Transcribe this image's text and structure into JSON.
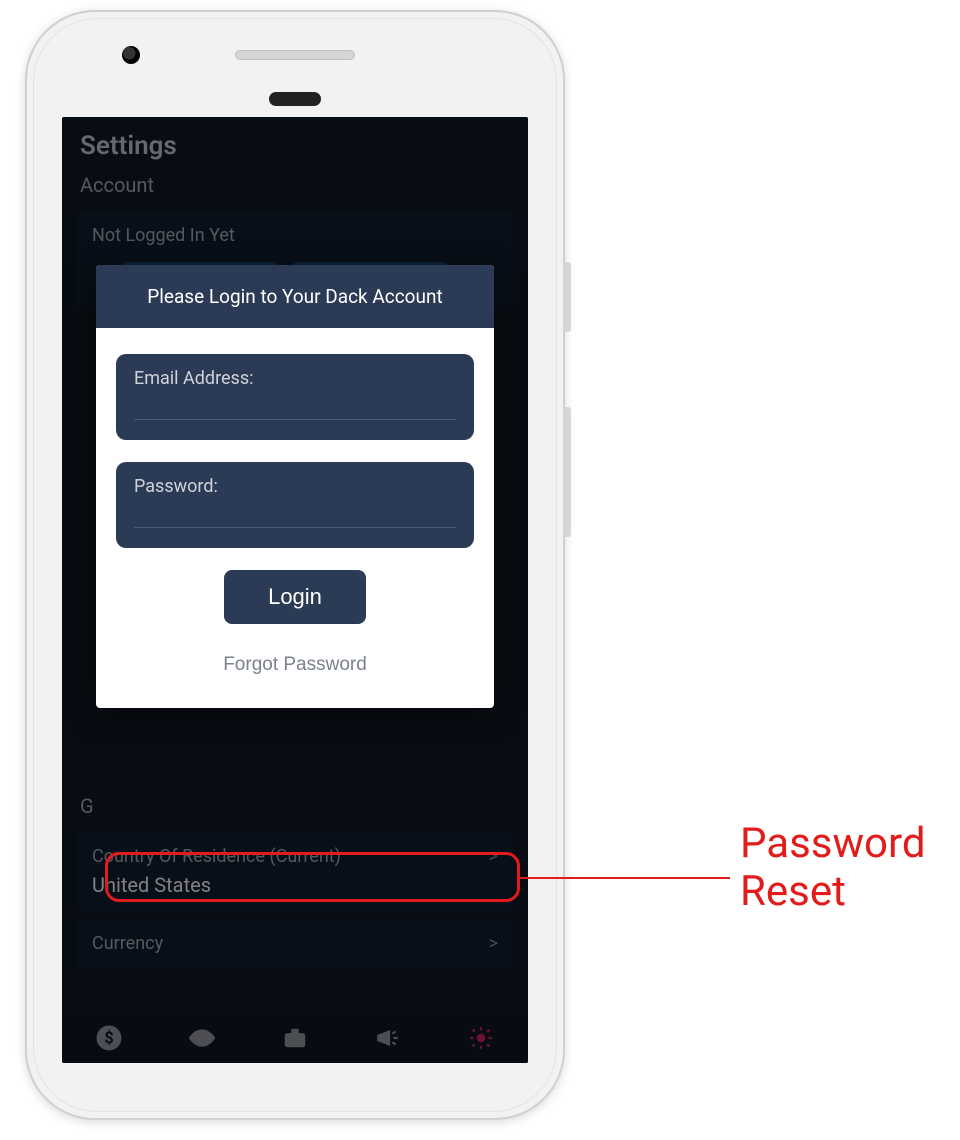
{
  "colors": {
    "navy": "#2b3a55",
    "accent": "#c2235a",
    "annotation": "#e21b1b"
  },
  "settings": {
    "title": "Settings",
    "account_label": "Account",
    "login_status": "Not Logged In Yet",
    "general_label": "G",
    "country_label": "Country Of Residence (Current)",
    "country_value": "United States",
    "currency_label": "Currency"
  },
  "modal": {
    "title": "Please Login to Your Dack Account",
    "email_label": "Email Address:",
    "password_label": "Password:",
    "login_button": "Login",
    "forgot_link": "Forgot Password"
  },
  "nav": {
    "items": [
      "money",
      "watch",
      "portfolio",
      "alerts",
      "settings"
    ],
    "active": "settings"
  },
  "annotation": {
    "label": "Password\nReset"
  }
}
